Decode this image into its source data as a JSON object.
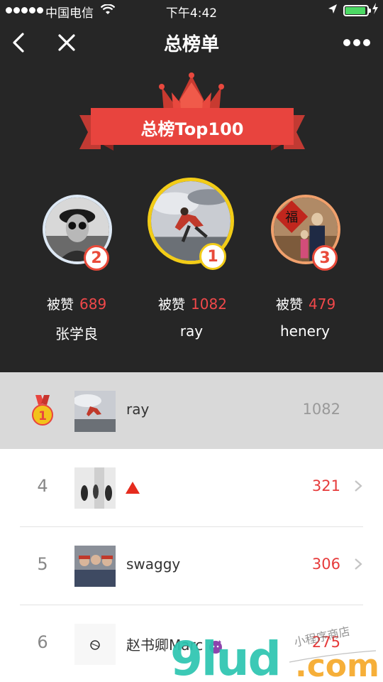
{
  "status_bar": {
    "carrier": "中国电信",
    "time": "下午4:42"
  },
  "nav": {
    "title": "总榜单"
  },
  "hero": {
    "banner": "总榜Top100",
    "podium": [
      {
        "rank": "2",
        "likes_label": "被赞",
        "likes": "689",
        "name": "张学良"
      },
      {
        "rank": "1",
        "likes_label": "被赞",
        "likes": "1082",
        "name": "ray"
      },
      {
        "rank": "3",
        "likes_label": "被赞",
        "likes": "479",
        "name": "henery"
      }
    ]
  },
  "list": {
    "current_user": {
      "rank": "1",
      "name": "ray",
      "score": "1082"
    },
    "rows": [
      {
        "rank": "4",
        "name": "",
        "score": "321"
      },
      {
        "rank": "5",
        "name": "swaggy",
        "score": "306"
      },
      {
        "rank": "6",
        "name": "赵书卿Marc",
        "score": "275"
      }
    ]
  },
  "watermark": {
    "text": "9lud.com",
    "handwriting": "小程序商店"
  },
  "colors": {
    "dark_bg": "#262626",
    "accent_red": "#e63b3b",
    "gold": "#f2cc17",
    "highlight_row": "#d9d9d9"
  }
}
